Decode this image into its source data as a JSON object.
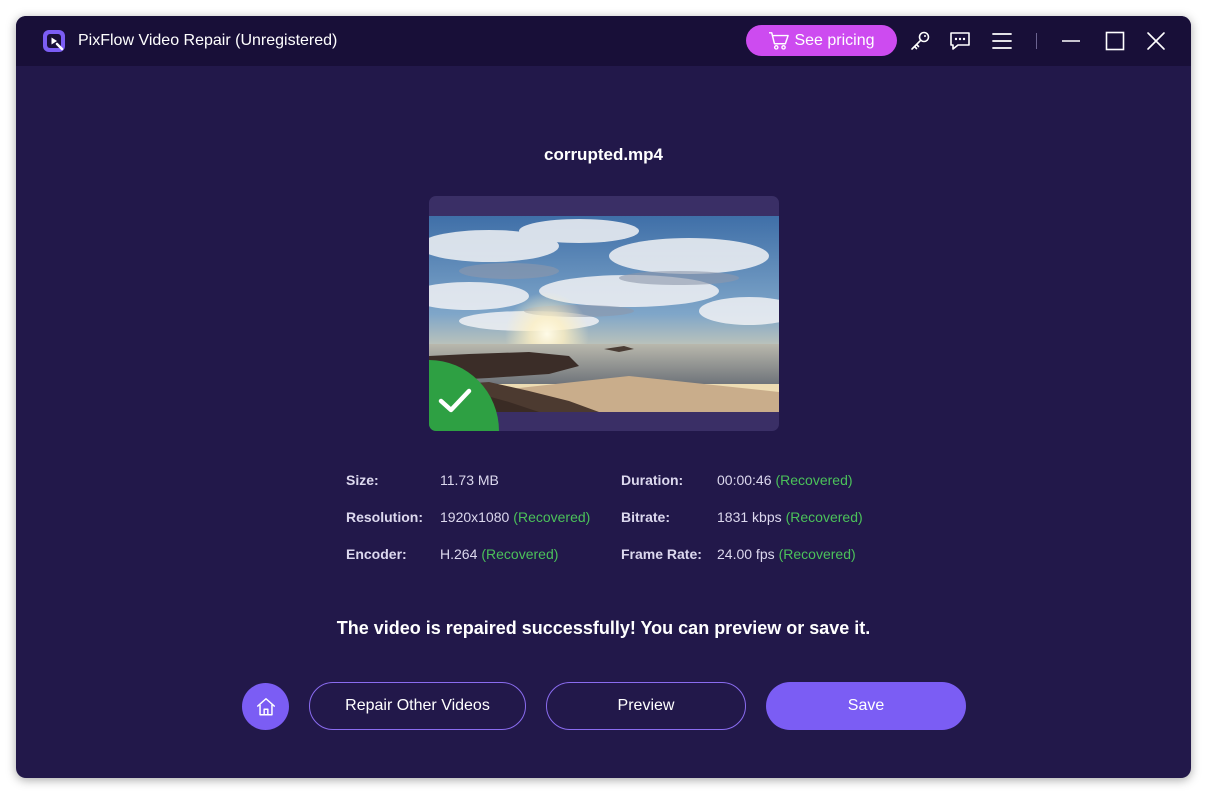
{
  "app": {
    "title": "PixFlow Video Repair (Unregistered)"
  },
  "titlebar": {
    "pricing_label": "See pricing",
    "icons": [
      "cart-icon",
      "key-icon",
      "feedback-icon",
      "menu-icon",
      "minimize-icon",
      "maximize-icon",
      "close-icon"
    ]
  },
  "file": {
    "name": "corrupted.mp4",
    "status": "repaired"
  },
  "info": {
    "size_label": "Size:",
    "size_value": "11.73 MB",
    "resolution_label": "Resolution:",
    "resolution_value": "1920x1080",
    "resolution_status": "(Recovered)",
    "encoder_label": "Encoder:",
    "encoder_value": "H.264",
    "encoder_status": "(Recovered)",
    "duration_label": "Duration:",
    "duration_value": "00:00:46",
    "duration_status": "(Recovered)",
    "bitrate_label": "Bitrate:",
    "bitrate_value": "1831 kbps",
    "bitrate_status": "(Recovered)",
    "framerate_label": "Frame Rate:",
    "framerate_value": "24.00 fps",
    "framerate_status": "(Recovered)"
  },
  "message": "The video is repaired successfully! You can preview or save it.",
  "actions": {
    "repair_other_label": "Repair Other Videos",
    "preview_label": "Preview",
    "save_label": "Save"
  },
  "colors": {
    "background": "#22184a",
    "titlebar": "#180f38",
    "pricing": "#cd4bf0",
    "accent": "#7b5df4",
    "recovered": "#4bc15a"
  }
}
